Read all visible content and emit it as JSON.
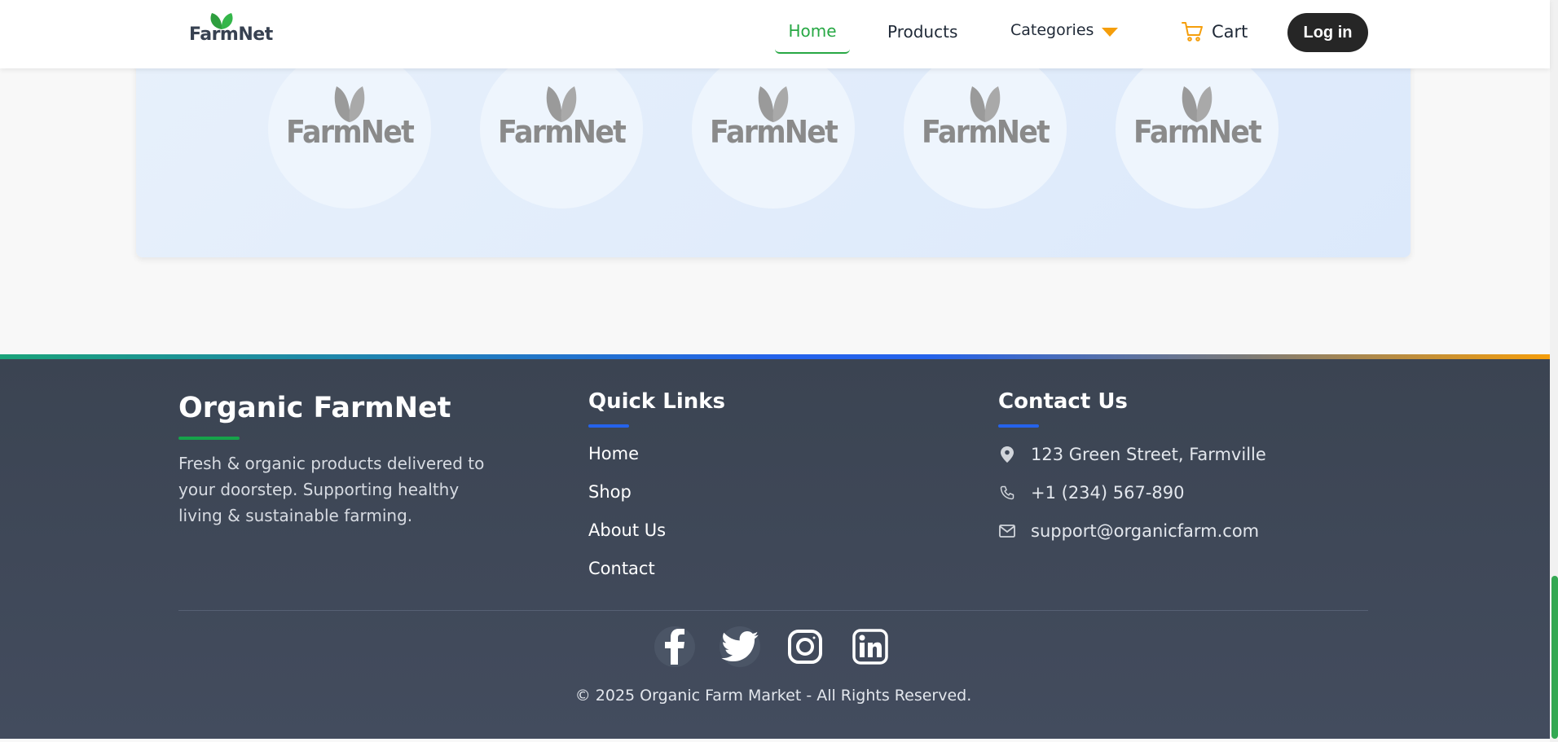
{
  "header": {
    "logo_text": "FarmNet",
    "nav": {
      "home": "Home",
      "products": "Products",
      "categories": "Categories"
    },
    "cart_label": "Cart",
    "login_label": "Log in"
  },
  "brands": [
    {
      "name": "FarmNet"
    },
    {
      "name": "FarmNet"
    },
    {
      "name": "FarmNet"
    },
    {
      "name": "FarmNet"
    },
    {
      "name": "FarmNet"
    }
  ],
  "footer": {
    "brand_title": "Organic FarmNet",
    "brand_description": "Fresh & organic products delivered to your doorstep. Supporting healthy living & sustainable farming.",
    "quick_links_title": "Quick Links",
    "quick_links": [
      "Home",
      "Shop",
      "About Us",
      "Contact"
    ],
    "contact_title": "Contact Us",
    "contact": {
      "address": "123 Green Street, Farmville",
      "phone": "+1 (234) 567-890",
      "email": "support@organicfarm.com"
    },
    "social": [
      "facebook-icon",
      "twitter-icon",
      "instagram-icon",
      "linkedin-icon"
    ],
    "copyright": "© 2025 Organic Farm Market - All Rights Reserved."
  },
  "colors": {
    "accent_green": "#27a844",
    "accent_orange": "#f59e0b",
    "accent_blue": "#2563eb",
    "footer_bg": "#3b4452",
    "login_bg": "#262626"
  }
}
